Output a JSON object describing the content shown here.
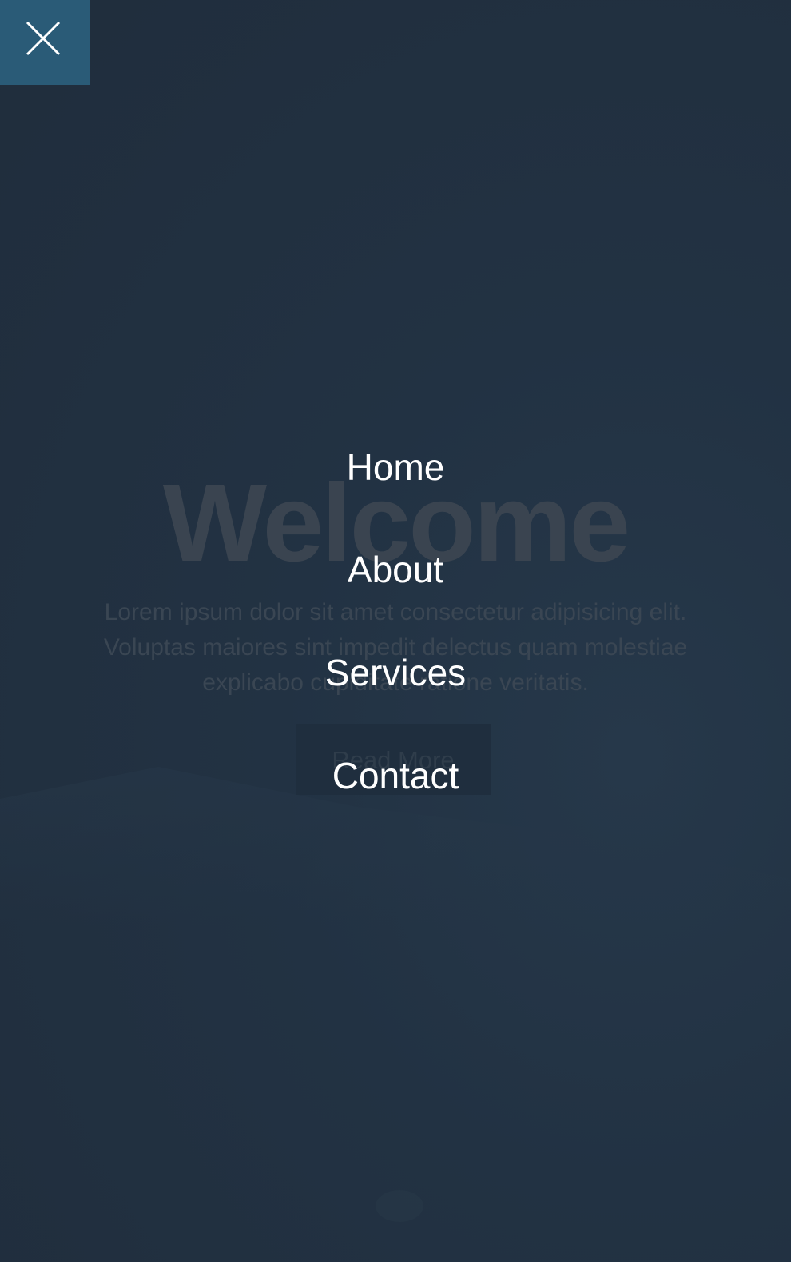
{
  "hero": {
    "title": "Welcome",
    "body_lines": [
      "Lorem ipsum dolor sit amet consectetur adipisicing elit.",
      "Voluptas maiores sint impedit delectus quam molestiae",
      "explicabo cupiditate ratione veritatis."
    ],
    "button_label": "Read More"
  },
  "menu": {
    "close_icon": "close-x-icon",
    "items": [
      {
        "label": "Home"
      },
      {
        "label": "About"
      },
      {
        "label": "Services"
      },
      {
        "label": "Contact"
      }
    ]
  },
  "colors": {
    "overlay": "#222f3e",
    "close_button": "#2a5b77",
    "menu_text": "#ffffff"
  }
}
